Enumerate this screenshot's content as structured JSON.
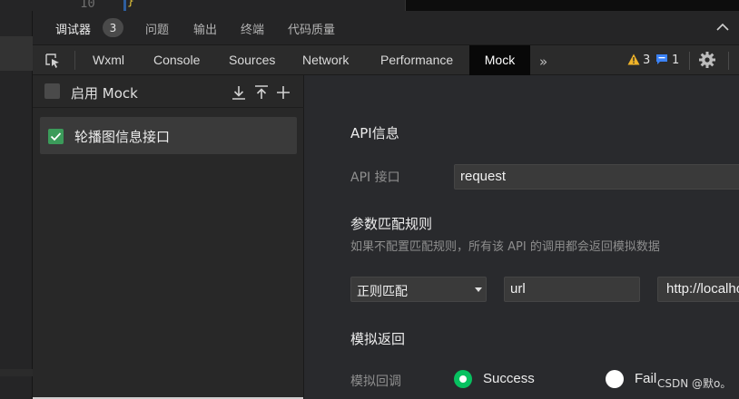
{
  "editor": {
    "line_number": "10",
    "bracket": "}"
  },
  "top_tabs": [
    {
      "label": "调试器",
      "active": true
    },
    {
      "label": "问题",
      "active": false
    },
    {
      "label": "输出",
      "active": false
    },
    {
      "label": "终端",
      "active": false
    },
    {
      "label": "代码质量",
      "active": false
    }
  ],
  "debugger_badge": "3",
  "panel_tabs": [
    {
      "label": "Wxml"
    },
    {
      "label": "Console"
    },
    {
      "label": "Sources"
    },
    {
      "label": "Network"
    },
    {
      "label": "Performance"
    },
    {
      "label": "Mock"
    }
  ],
  "toolbar": {
    "more": "»",
    "warning_count": "3",
    "message_count": "1"
  },
  "mock_list": {
    "enable_label": "启用 Mock",
    "items": [
      {
        "label": "轮播图信息接口",
        "checked": true
      }
    ]
  },
  "detail": {
    "api_info_title": "API信息",
    "api_label": "API 接口",
    "api_value": "request",
    "match_title": "参数匹配规则",
    "match_hint": "如果不配置匹配规则，所有该 API 的调用都会返回模拟数据",
    "match_type": "正则匹配",
    "match_key": "url",
    "match_value": "http://localhost",
    "return_title": "模拟返回",
    "callback_label": "模拟回调",
    "success_label": "Success",
    "fail_label": "Fail"
  },
  "watermark": "CSDN @默o。",
  "colors": {
    "accent_green": "#07c160",
    "checkbox_green": "#3b9b5a",
    "warning": "#f0b429",
    "info": "#3b82f6"
  }
}
